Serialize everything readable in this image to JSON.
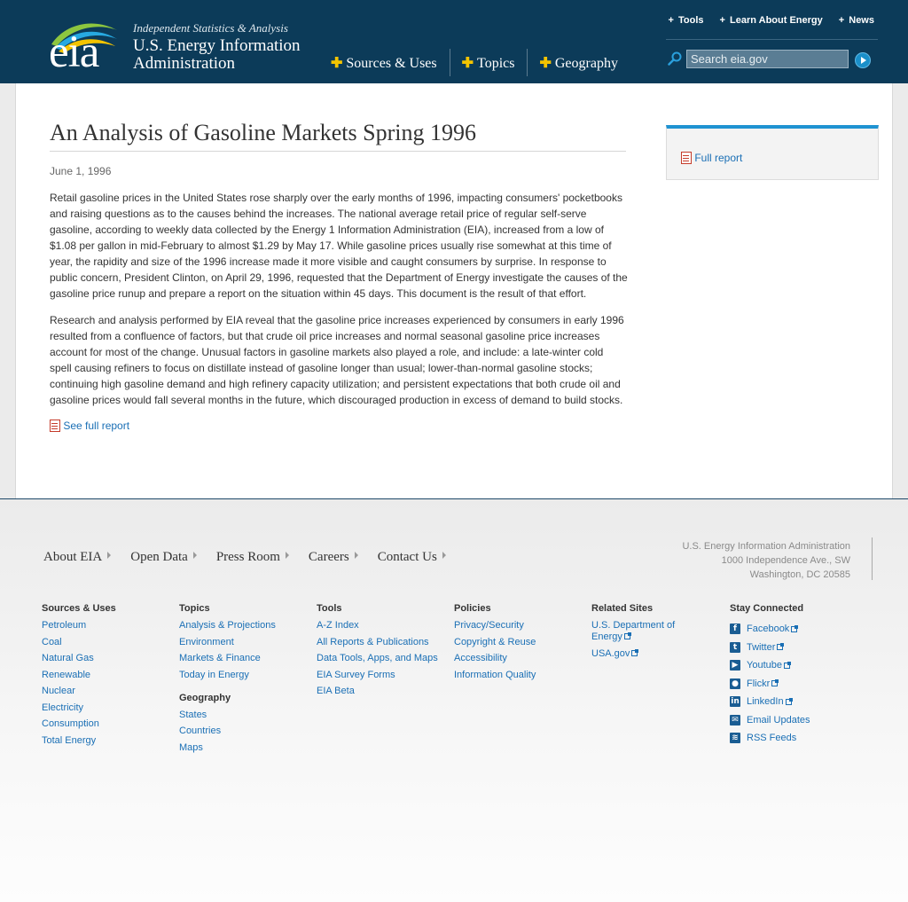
{
  "header": {
    "logo_text": "eia",
    "tagline": "Independent Statistics & Analysis",
    "org_name": "U.S. Energy Information Administration",
    "main_nav": [
      "Sources & Uses",
      "Topics",
      "Geography"
    ],
    "util_nav": [
      "Tools",
      "Learn About Energy",
      "News"
    ],
    "search_placeholder": "Search eia.gov"
  },
  "article": {
    "title": "An Analysis of Gasoline Markets Spring 1996",
    "date": "June 1, 1996",
    "paragraphs": [
      "Retail gasoline prices in the United States rose sharply over the early months of 1996, impacting consumers' pocketbooks and raising questions as to the causes behind the increases. The national average retail price of regular self-serve gasoline, according to weekly data collected by the Energy 1 Information Administration (EIA), increased from a low of $1.08 per gallon in mid-February to almost $1.29 by May 17. While gasoline prices usually rise somewhat at this time of year, the rapidity and size of the 1996 increase made it more visible and caught consumers by surprise. In response to public concern, President Clinton, on April 29, 1996, requested that the Department of Energy investigate the causes of the gasoline price runup and prepare a report on the situation within 45 days. This document is the result of that effort.",
      "Research and analysis performed by EIA reveal that the gasoline price increases experienced by consumers in early 1996 resulted from a confluence of factors, but that crude oil price increases and normal seasonal gasoline price increases account for most of the change. Unusual factors in gasoline markets also played a role, and include: a late-winter cold spell causing refiners to focus on distillate instead of gasoline longer than usual; lower-than-normal gasoline stocks; continuing high gasoline demand and high refinery capacity utilization; and persistent expectations that both crude oil and gasoline prices would fall several months in the future, which discouraged production in excess of demand to build stocks."
    ],
    "see_full_report": "See full report"
  },
  "sidebar": {
    "full_report": "Full report"
  },
  "footer": {
    "nav": [
      "About EIA",
      "Open Data",
      "Press Room",
      "Careers",
      "Contact Us"
    ],
    "address": [
      "U.S. Energy Information Administration",
      "1000 Independence Ave., SW",
      "Washington, DC 20585"
    ],
    "columns": {
      "sources": {
        "head": "Sources & Uses",
        "links": [
          "Petroleum",
          "Coal",
          "Natural Gas",
          "Renewable",
          "Nuclear",
          "Electricity",
          "Consumption",
          "Total Energy"
        ]
      },
      "topics": {
        "head": "Topics",
        "links": [
          "Analysis & Projections",
          "Environment",
          "Markets & Finance",
          "Today in Energy"
        ]
      },
      "geography": {
        "head": "Geography",
        "links": [
          "States",
          "Countries",
          "Maps"
        ]
      },
      "tools": {
        "head": "Tools",
        "links": [
          "A-Z Index",
          "All Reports & Publications",
          "Data Tools, Apps, and Maps",
          "EIA Survey Forms",
          "EIA Beta"
        ]
      },
      "policies": {
        "head": "Policies",
        "links": [
          "Privacy/Security",
          "Copyright & Reuse",
          "Accessibility",
          "Information Quality"
        ]
      },
      "related": {
        "head": "Related Sites",
        "links": [
          "U.S. Department of Energy",
          "USA.gov"
        ]
      },
      "connected": {
        "head": "Stay Connected",
        "links": [
          "Facebook",
          "Twitter",
          "Youtube",
          "Flickr",
          "LinkedIn",
          "Email Updates",
          "RSS Feeds"
        ]
      }
    }
  },
  "colors": {
    "header_bg": "#0c3b59",
    "accent_blue": "#1f93d2",
    "link": "#1a6fb5",
    "plus": "#f4c400"
  }
}
